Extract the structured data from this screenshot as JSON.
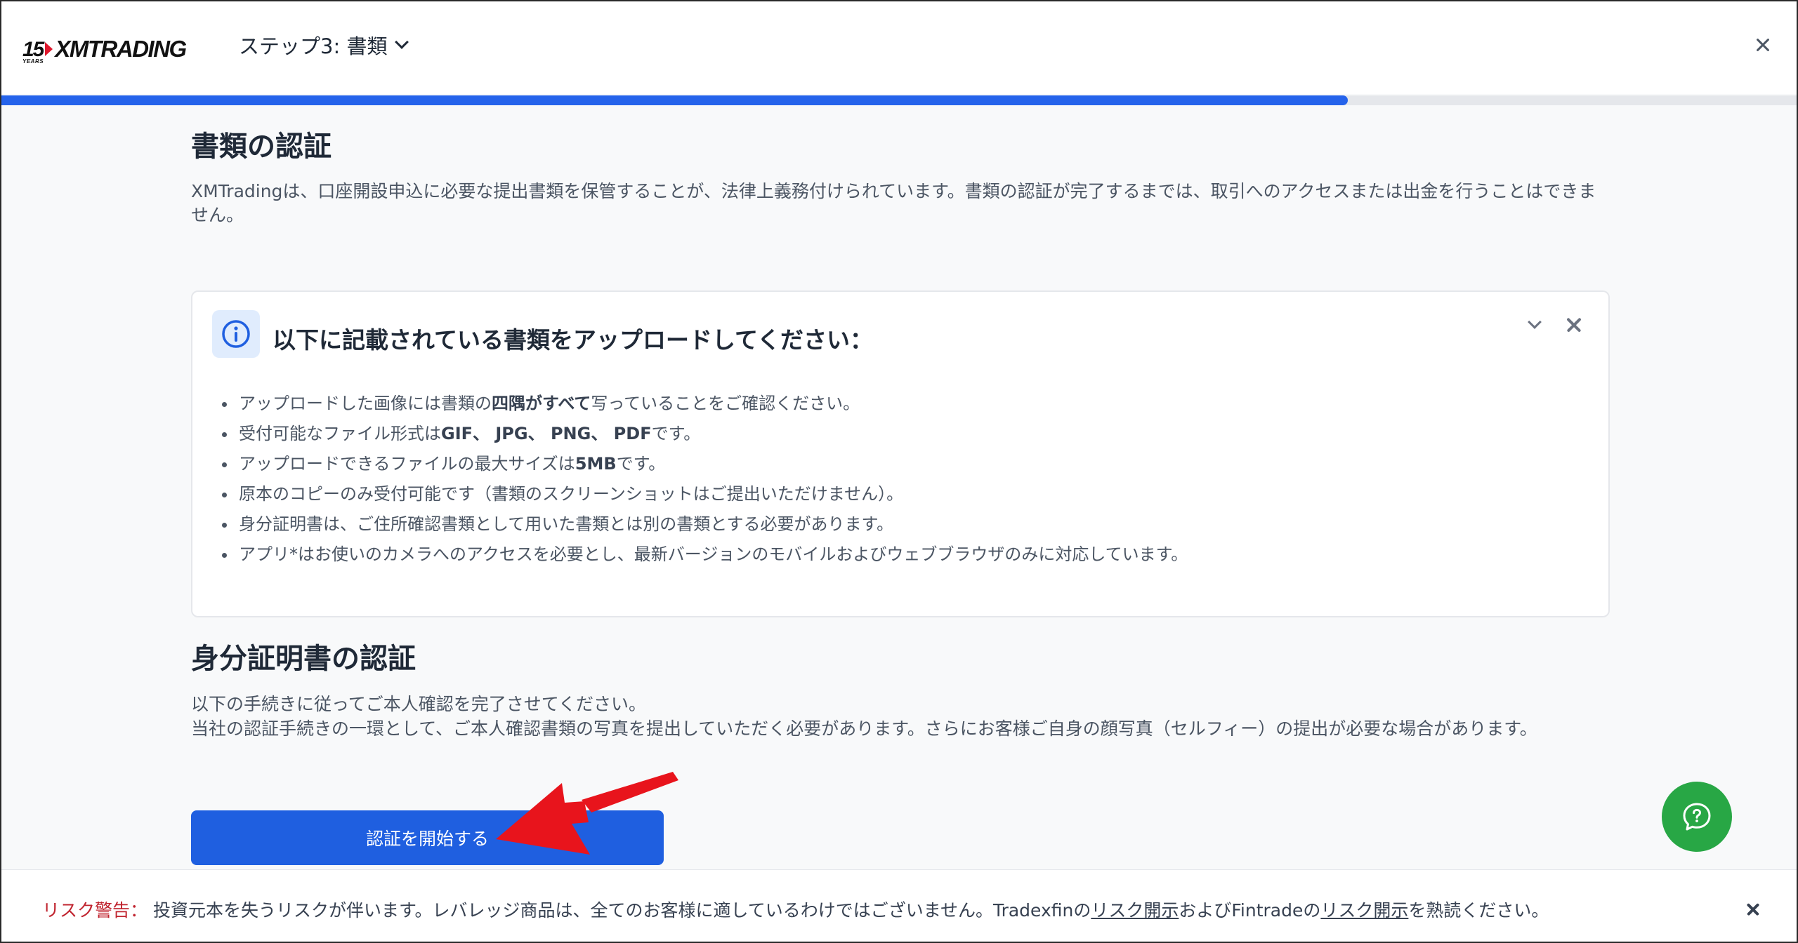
{
  "header": {
    "logo": {
      "years": "15",
      "years_caption": "YEARS",
      "brand": "XMTRADING"
    },
    "step_label": "ステップ3: 書類"
  },
  "progress": {
    "percent": 75
  },
  "documents": {
    "title": "書類の認証",
    "description": "XMTradingは、口座開設申込に必要な提出書類を保管することが、法律上義務付けられています。書類の認証が完了するまでは、取引へのアクセスまたは出金を行うことはできません。"
  },
  "info_card": {
    "title": "以下に記載されている書類をアップロードしてください：",
    "items": [
      {
        "a": "アップロードした画像には書類の",
        "b": "四隅がすべて",
        "c": "写っていることをご確認ください。"
      },
      {
        "a": "受付可能なファイル形式は",
        "b": "GIF、 JPG、 PNG、 PDF",
        "c": "です。"
      },
      {
        "a": "アップロードできるファイルの最大サイズは",
        "b": "5MB",
        "c": "です。"
      },
      {
        "a": "原本のコピーのみ受付可能です（書類のスクリーンショットはご提出いただけません）。",
        "b": "",
        "c": ""
      },
      {
        "a": "身分証明書は、ご住所確認書類として用いた書類とは別の書類とする必要があります。",
        "b": "",
        "c": ""
      },
      {
        "a": "アプリ*はお使いのカメラへのアクセスを必要とし、最新バージョンのモバイルおよびウェブブラウザのみに対応しています。",
        "b": "",
        "c": ""
      }
    ]
  },
  "identity": {
    "title": "身分証明書の認証",
    "line1": "以下の手続きに従ってご本人確認を完了させてください。",
    "line2": "当社の認証手続きの一環として、ご本人確認書類の写真を提出していただく必要があります。さらにお客様ご自身の顔写真（セルフィー）の提出が必要な場合があります。",
    "start_button": "認証を開始する"
  },
  "risk": {
    "label": "リスク警告：",
    "text1": " 投資元本を失うリスクが伴います。レバレッジ商品は、全てのお客様に適しているわけではございません。Tradexfinの",
    "link1": "リスク開示",
    "text2": "およびFintradeの",
    "link2": "リスク開示",
    "text3": "を熟読ください。"
  },
  "colors": {
    "primary": "#1f5fe0",
    "progress": "#2563eb",
    "help": "#28a745",
    "warning": "#c0242f",
    "arrow": "#e8141c"
  },
  "icons": [
    "chevron-down-icon",
    "close-icon",
    "info-icon",
    "help-chat-icon",
    "arrow-annotation"
  ]
}
